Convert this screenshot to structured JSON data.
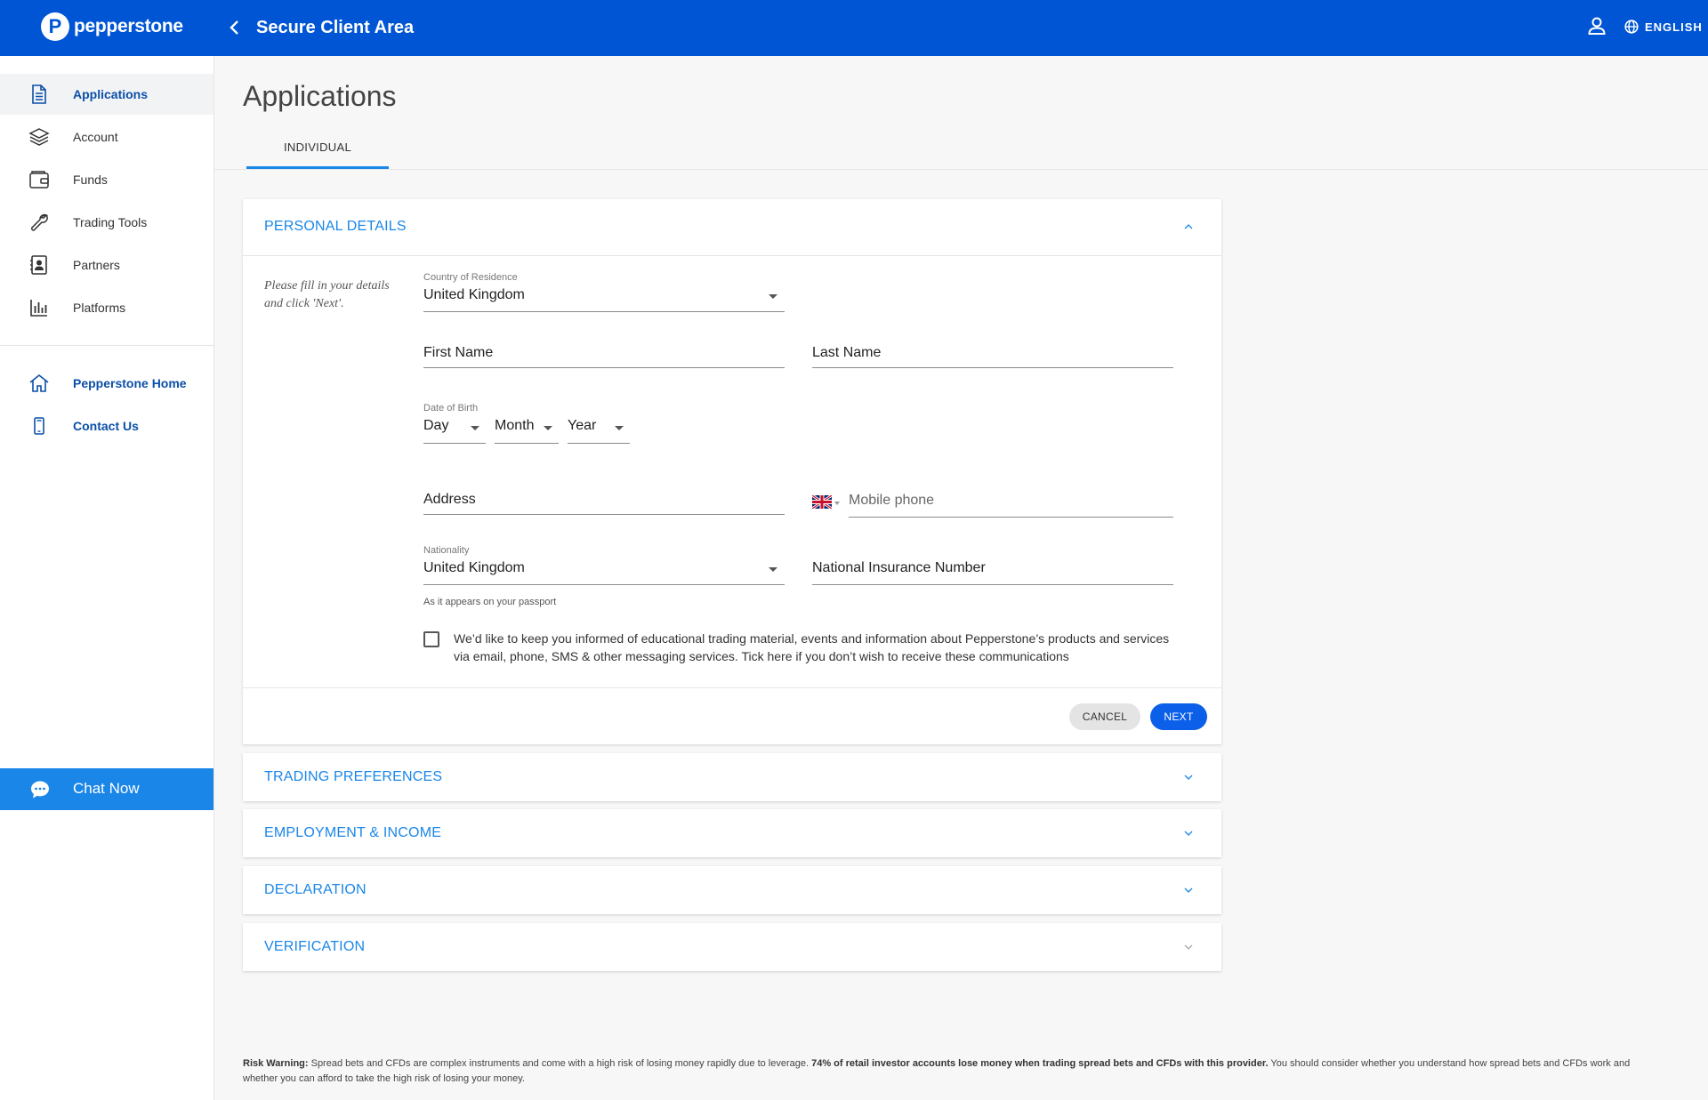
{
  "header": {
    "brand": "pepperstone",
    "title": "Secure Client Area",
    "language": "ENGLISH"
  },
  "sidebar": {
    "items": [
      {
        "label": "Applications",
        "icon": "document-icon"
      },
      {
        "label": "Account",
        "icon": "layers-icon"
      },
      {
        "label": "Funds",
        "icon": "wallet-icon"
      },
      {
        "label": "Trading Tools",
        "icon": "wrench-icon"
      },
      {
        "label": "Partners",
        "icon": "contact-card-icon"
      },
      {
        "label": "Platforms",
        "icon": "bar-chart-icon"
      }
    ],
    "links": [
      {
        "label": "Pepperstone Home",
        "icon": "home-icon"
      },
      {
        "label": "Contact Us",
        "icon": "phone-icon"
      }
    ],
    "chat_label": "Chat Now"
  },
  "page": {
    "title": "Applications",
    "tab": "INDIVIDUAL"
  },
  "personal_details": {
    "title": "PERSONAL DETAILS",
    "hint": "Please fill in your details and click 'Next'.",
    "country_label": "Country of Residence",
    "country_value": "United Kingdom",
    "first_name": "First Name",
    "last_name": "Last Name",
    "dob_label": "Date of Birth",
    "dob_day": "Day",
    "dob_month": "Month",
    "dob_year": "Year",
    "address": "Address",
    "mobile_placeholder": "Mobile phone",
    "nationality_label": "Nationality",
    "nationality_value": "United Kingdom",
    "nationality_helper": "As it appears on your passport",
    "ni_number": "National Insurance Number",
    "consent_text": "We’d like to keep you informed of educational trading material, events and information about Pepperstone’s products and services via email, phone, SMS & other messaging services. Tick here if you don’t wish to receive these communications",
    "cancel_label": "CANCEL",
    "next_label": "NEXT"
  },
  "sections": [
    {
      "title": "TRADING PREFERENCES"
    },
    {
      "title": "EMPLOYMENT & INCOME"
    },
    {
      "title": "DECLARATION"
    },
    {
      "title": "VERIFICATION"
    }
  ],
  "risk_warning": {
    "label": "Risk Warning:",
    "text1": " Spread bets and CFDs are complex instruments and come with a high risk of losing money rapidly due to leverage. ",
    "bold": "74% of retail investor accounts lose money when trading spread bets and CFDs with this provider.",
    "text2": " You should consider whether you understand how spread bets and CFDs work and whether you can afford to take the high risk of losing your money."
  },
  "colors": {
    "brand_blue": "#0055d4",
    "accent_blue": "#1a86e8",
    "next_button": "#0b5fe8"
  }
}
